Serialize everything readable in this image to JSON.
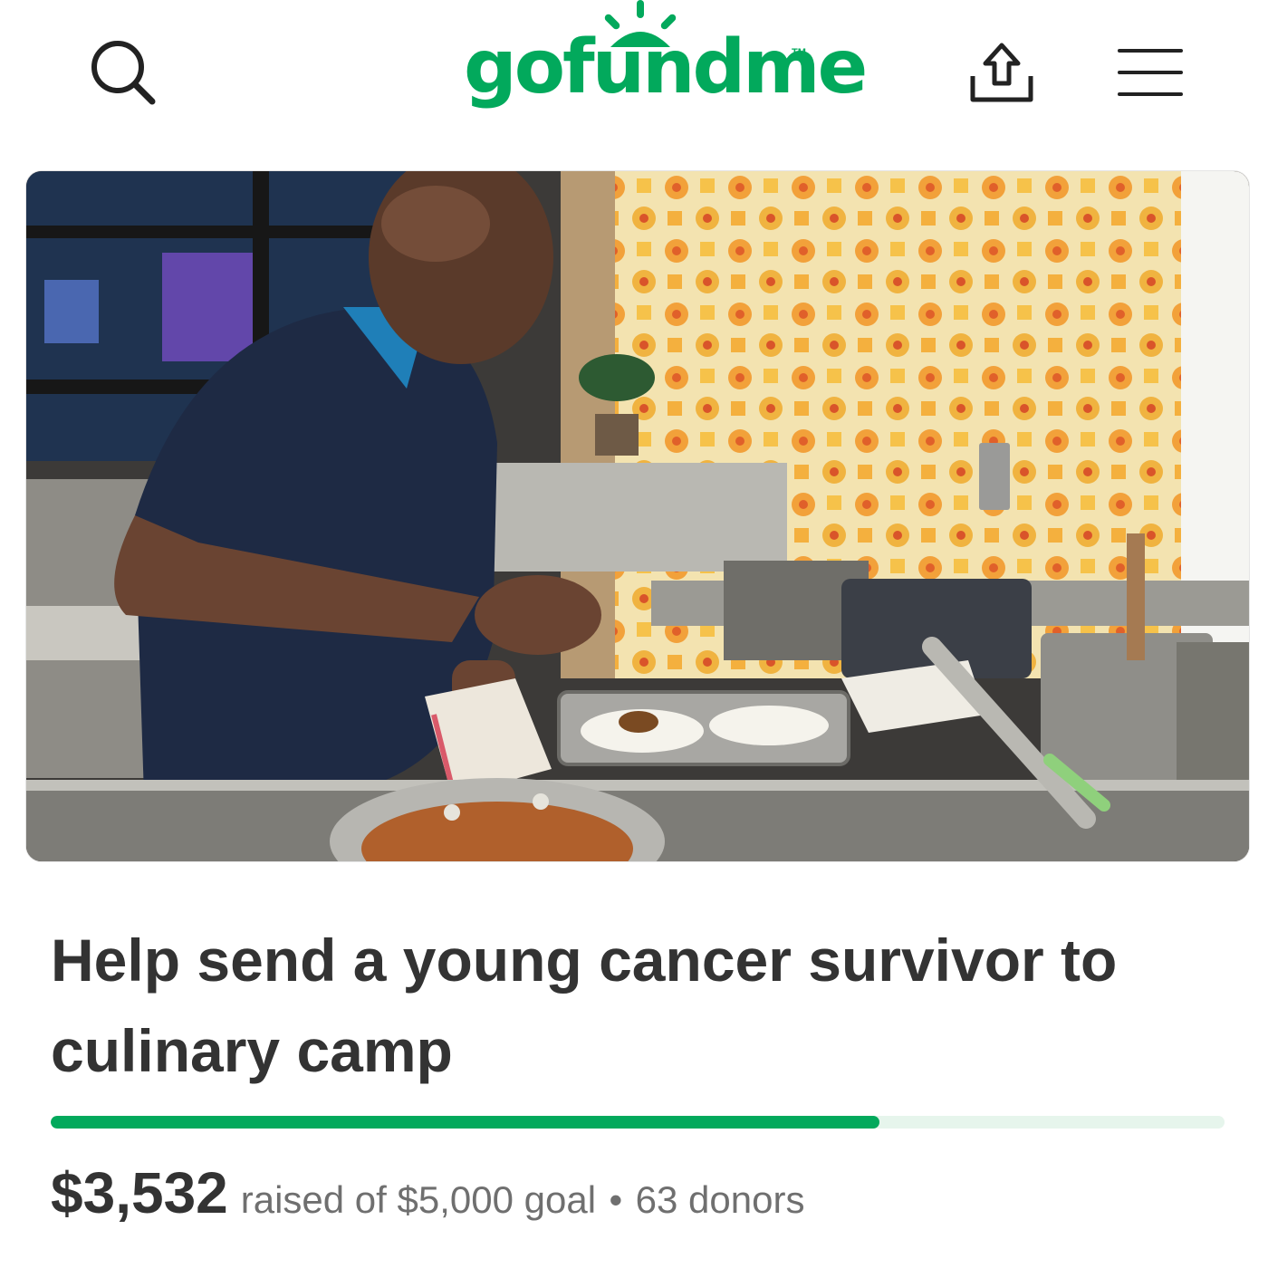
{
  "header": {
    "logo_text": "gofundme",
    "logo_tm": "TM",
    "brand_color": "#02a95c",
    "icons": [
      "search-icon",
      "share-icon",
      "menu-icon"
    ]
  },
  "fundraiser": {
    "title": "Help send a young cancer survivor to culinary camp",
    "raised": "$3,532",
    "raised_text": "raised of $5,000 goal",
    "separator": "•",
    "donors_text": "63 donors",
    "progress_fraction": 0.7064
  }
}
